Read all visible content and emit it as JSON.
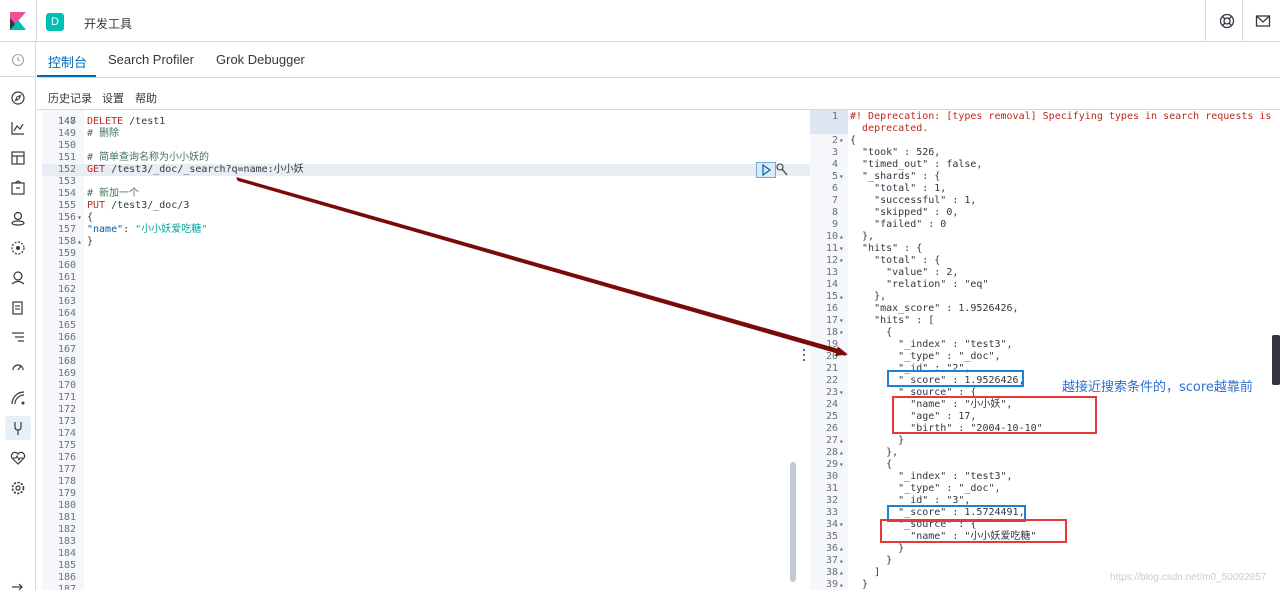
{
  "header": {
    "space_letter": "D",
    "title": "开发工具"
  },
  "tabs": [
    {
      "label": "控制台"
    },
    {
      "label": "Search Profiler"
    },
    {
      "label": "Grok Debugger"
    }
  ],
  "menu": {
    "history": "历史记录",
    "settings": "设置",
    "help": "帮助"
  },
  "editor": {
    "top_partial_ln": "147",
    "top_partial_text": "# 删除",
    "lines": [
      {
        "ln": "148",
        "fold": "",
        "parts": [
          {
            "t": "DELETE ",
            "c": "c-method"
          },
          {
            "t": "/test1",
            "c": "c-url"
          }
        ]
      },
      {
        "ln": "149",
        "fold": "",
        "parts": []
      },
      {
        "ln": "150",
        "fold": "",
        "parts": []
      },
      {
        "ln": "151",
        "fold": "",
        "parts": [
          {
            "t": "# 简单查询名称为小小妖的",
            "c": "c-comment"
          }
        ]
      },
      {
        "ln": "152",
        "fold": "",
        "parts": [
          {
            "t": "GET ",
            "c": "c-method"
          },
          {
            "t": "/test3/_doc/_search?q=name:小小妖",
            "c": "c-url"
          }
        ],
        "hl": true
      },
      {
        "ln": "153",
        "fold": "",
        "parts": []
      },
      {
        "ln": "154",
        "fold": "",
        "parts": [
          {
            "t": "# 新加一个",
            "c": "c-comment"
          }
        ]
      },
      {
        "ln": "155",
        "fold": "",
        "parts": [
          {
            "t": "PUT ",
            "c": "c-method"
          },
          {
            "t": "/test3/_doc/3",
            "c": "c-url"
          }
        ]
      },
      {
        "ln": "156",
        "fold": "▾",
        "parts": [
          {
            "t": "{",
            "c": "c-url"
          }
        ]
      },
      {
        "ln": "157",
        "fold": "",
        "parts": [
          {
            "t": "\"name\"",
            "c": "c-key"
          },
          {
            "t": ": ",
            "c": "c-url"
          },
          {
            "t": "\"小小妖爱吃糖\"",
            "c": "c-str"
          }
        ]
      },
      {
        "ln": "158",
        "fold": "▴",
        "parts": [
          {
            "t": "}",
            "c": "c-url"
          }
        ]
      },
      {
        "ln": "159"
      },
      {
        "ln": "160"
      },
      {
        "ln": "161"
      },
      {
        "ln": "162"
      },
      {
        "ln": "163"
      },
      {
        "ln": "164"
      },
      {
        "ln": "165"
      },
      {
        "ln": "166"
      },
      {
        "ln": "167"
      },
      {
        "ln": "168"
      },
      {
        "ln": "169"
      },
      {
        "ln": "170"
      },
      {
        "ln": "171"
      },
      {
        "ln": "172"
      },
      {
        "ln": "173"
      },
      {
        "ln": "174"
      },
      {
        "ln": "175"
      },
      {
        "ln": "176"
      },
      {
        "ln": "177"
      },
      {
        "ln": "178"
      },
      {
        "ln": "179"
      },
      {
        "ln": "180"
      },
      {
        "ln": "181"
      },
      {
        "ln": "182"
      },
      {
        "ln": "183"
      },
      {
        "ln": "184"
      },
      {
        "ln": "185"
      },
      {
        "ln": "186"
      },
      {
        "ln": "187"
      }
    ]
  },
  "output": {
    "lines": [
      {
        "ln": "1",
        "fold": "",
        "text": "#! Deprecation: [types removal] Specifying types in search requests is",
        "cls": "depr"
      },
      {
        "ln": "",
        "fold": "",
        "text": "  deprecated.",
        "cls": "depr"
      },
      {
        "ln": "2",
        "fold": "▾",
        "text": "{"
      },
      {
        "ln": "3",
        "fold": "",
        "text": "  \"took\" : 526,"
      },
      {
        "ln": "4",
        "fold": "",
        "text": "  \"timed_out\" : false,"
      },
      {
        "ln": "5",
        "fold": "▾",
        "text": "  \"_shards\" : {"
      },
      {
        "ln": "6",
        "fold": "",
        "text": "    \"total\" : 1,"
      },
      {
        "ln": "7",
        "fold": "",
        "text": "    \"successful\" : 1,"
      },
      {
        "ln": "8",
        "fold": "",
        "text": "    \"skipped\" : 0,"
      },
      {
        "ln": "9",
        "fold": "",
        "text": "    \"failed\" : 0"
      },
      {
        "ln": "10",
        "fold": "▴",
        "text": "  },"
      },
      {
        "ln": "11",
        "fold": "▾",
        "text": "  \"hits\" : {"
      },
      {
        "ln": "12",
        "fold": "▾",
        "text": "    \"total\" : {"
      },
      {
        "ln": "13",
        "fold": "",
        "text": "      \"value\" : 2,"
      },
      {
        "ln": "14",
        "fold": "",
        "text": "      \"relation\" : \"eq\""
      },
      {
        "ln": "15",
        "fold": "▴",
        "text": "    },"
      },
      {
        "ln": "16",
        "fold": "",
        "text": "    \"max_score\" : 1.9526426,"
      },
      {
        "ln": "17",
        "fold": "▾",
        "text": "    \"hits\" : ["
      },
      {
        "ln": "18",
        "fold": "▾",
        "text": "      {"
      },
      {
        "ln": "19",
        "fold": "",
        "text": "        \"_index\" : \"test3\","
      },
      {
        "ln": "20",
        "fold": "",
        "text": "        \"_type\" : \"_doc\","
      },
      {
        "ln": "21",
        "fold": "",
        "text": "        \"_id\" : \"2\","
      },
      {
        "ln": "22",
        "fold": "",
        "text": "        \"_score\" : 1.9526426,"
      },
      {
        "ln": "23",
        "fold": "▾",
        "text": "        \"_source\" : {"
      },
      {
        "ln": "24",
        "fold": "",
        "text": "          \"name\" : \"小小妖\","
      },
      {
        "ln": "25",
        "fold": "",
        "text": "          \"age\" : 17,"
      },
      {
        "ln": "26",
        "fold": "",
        "text": "          \"birth\" : \"2004-10-10\""
      },
      {
        "ln": "27",
        "fold": "▴",
        "text": "        }"
      },
      {
        "ln": "28",
        "fold": "▴",
        "text": "      },"
      },
      {
        "ln": "29",
        "fold": "▾",
        "text": "      {"
      },
      {
        "ln": "30",
        "fold": "",
        "text": "        \"_index\" : \"test3\","
      },
      {
        "ln": "31",
        "fold": "",
        "text": "        \"_type\" : \"_doc\","
      },
      {
        "ln": "32",
        "fold": "",
        "text": "        \"_id\" : \"3\","
      },
      {
        "ln": "33",
        "fold": "",
        "text": "        \"_score\" : 1.5724491,"
      },
      {
        "ln": "34",
        "fold": "▾",
        "text": "        \"_source\" : {"
      },
      {
        "ln": "35",
        "fold": "",
        "text": "          \"name\" : \"小小妖爱吃糖\""
      },
      {
        "ln": "36",
        "fold": "▴",
        "text": "        }"
      },
      {
        "ln": "37",
        "fold": "▴",
        "text": "      }"
      },
      {
        "ln": "38",
        "fold": "▴",
        "text": "    ]"
      },
      {
        "ln": "39",
        "fold": "▴",
        "text": "  }"
      }
    ]
  },
  "annotation": "越接近搜索条件的，score越靠前",
  "watermark": "https://blog.csdn.net/m0_50092857",
  "colors": {
    "accent": "#006bb4",
    "space_badge": "#00bfb3",
    "annotation_blue": "#2f6fd1",
    "box_blue": "#1f7fd6",
    "box_red": "#e53935",
    "arrow": "#7a0a0a"
  }
}
